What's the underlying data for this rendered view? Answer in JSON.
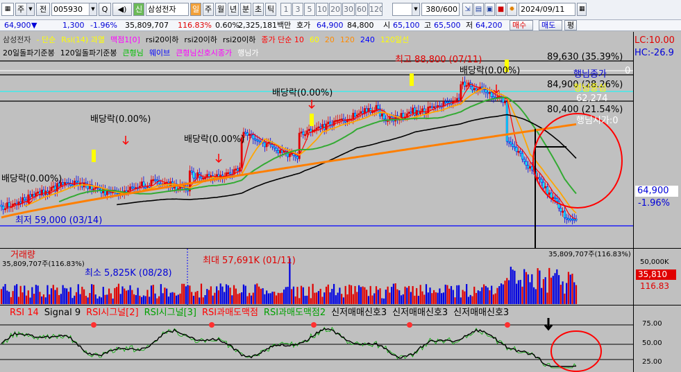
{
  "toolbar": {
    "mode": "주",
    "period_selector": "전",
    "code": "005930",
    "search_label": "Q",
    "credit_label": "신",
    "stock_name": "삼성전자",
    "period_buttons": [
      "일",
      "주",
      "월",
      "년",
      "분",
      "초",
      "틱"
    ],
    "minute_buttons": [
      "1",
      "3",
      "5",
      "10",
      "20",
      "30",
      "60",
      "120"
    ],
    "count_value": "380/600",
    "date_value": "2024/09/11",
    "icons": [
      "arrow-tool-icon",
      "chart-settings-icon",
      "save-icon",
      "stop-icon",
      "gear-icon",
      "calendar-icon"
    ]
  },
  "quote": {
    "price": "64,900",
    "price_arrow": "▼",
    "change": "1,300",
    "change_pct": "-1.96%",
    "volume": "35,809,707",
    "volume_ratio": "116.83%",
    "turnover_pct": "0.60%",
    "amount": "2,325,181백만",
    "ask_label": "호가",
    "ask": "64,900",
    "bid_label": "84,800",
    "open_label": "시",
    "open": "65,100",
    "high_label": "고",
    "high": "65,500",
    "low_label": "저",
    "low": "64,200",
    "buttons": [
      "매수",
      "매도",
      "평"
    ]
  },
  "price_pane": {
    "legend_row1": [
      {
        "text": "삼성전자",
        "color": "#333333"
      },
      {
        "text": "- 단순",
        "color": "#ffff00"
      },
      {
        "text": "Rsi(14) 과열",
        "color": "#ffff00"
      },
      {
        "text": "맥점1[0]",
        "color": "#ff00ff"
      },
      {
        "text": "rsi20이하",
        "color": "#000000"
      },
      {
        "text": "rsi20이하",
        "color": "#000000"
      },
      {
        "text": "rsi20이하",
        "color": "#000000"
      },
      {
        "text": "종가 단순 10",
        "color": "#ff0000"
      },
      {
        "text": "60",
        "color": "#ffff00"
      },
      {
        "text": "20",
        "color": "#ff8c00"
      },
      {
        "text": "120",
        "color": "#ff8c00"
      },
      {
        "text": "240",
        "color": "#0000ff"
      },
      {
        "text": "120일선",
        "color": "#ffff00"
      }
    ],
    "legend_row2": [
      {
        "text": "20일돌파기준봉",
        "color": "#000000"
      },
      {
        "text": "120일돌파기준봉",
        "color": "#000000"
      },
      {
        "text": "큰형님",
        "color": "#00c000"
      },
      {
        "text": "웨이브",
        "color": "#0000ff"
      },
      {
        "text": "큰형님신호시종가",
        "color": "#ff00ff"
      },
      {
        "text": "행님가",
        "color": "#ffffff"
      }
    ],
    "lc_label": "LC:10.00",
    "hc_label": "HC:-26.9",
    "dividend_labels": [
      "배당락(0.00%)",
      "배당락(0.00%)",
      "배당락(0.00%)",
      "배당락(0.00%)",
      "배당락(0.00%)"
    ],
    "high_label": "최고 88,800 (07/11)",
    "low_label": "최저 59,000 (03/14)",
    "levels": [
      "89,630 (35.39%)",
      "84,900 (28.26%)",
      "80,400 (21.54%)"
    ],
    "brother_labels": [
      "행님종가",
      "형님중심",
      "62,274",
      "행님시가:0",
      "0"
    ],
    "current_price": "64,900",
    "current_pct": "-1.96%"
  },
  "volume_pane": {
    "legend": "거래량",
    "current_volume": "35,809,707주(116.83%)",
    "right_volume": "35,809,707주(116.83%)",
    "max_label": "최대 57,691K (01/11)",
    "min_label": "최소 5,825K (08/28)",
    "axis_tick": "50,000K",
    "current_box": "35,810",
    "current_ratio": "116.83"
  },
  "rsi_pane": {
    "legend": [
      {
        "text": "RSI 14",
        "color": "#ff0000"
      },
      {
        "text": "Signal 9",
        "color": "#000000"
      },
      {
        "text": "RSI시그널[2]",
        "color": "#ff0000"
      },
      {
        "text": "RSI시그널[3]",
        "color": "#00a000"
      },
      {
        "text": "RSI과매도맥점",
        "color": "#ff0000"
      },
      {
        "text": "RSI과매도맥점2",
        "color": "#00a000"
      },
      {
        "text": "신저매매신호3",
        "color": "#000000"
      },
      {
        "text": "신저매매신호3",
        "color": "#000000"
      },
      {
        "text": "신저매매신호3",
        "color": "#000000"
      }
    ],
    "ticks": [
      "75.00",
      "50.00",
      "25.00"
    ]
  },
  "colors": {
    "background": "#c0c0c0",
    "up": "#e00000",
    "down": "#0000e0",
    "ma10": "#ff0000",
    "ma20": "#ffa500",
    "ma60": "#33aa33",
    "ma120": "#000000",
    "ma240": "#ff7f00",
    "circle": "#ff0000"
  }
}
